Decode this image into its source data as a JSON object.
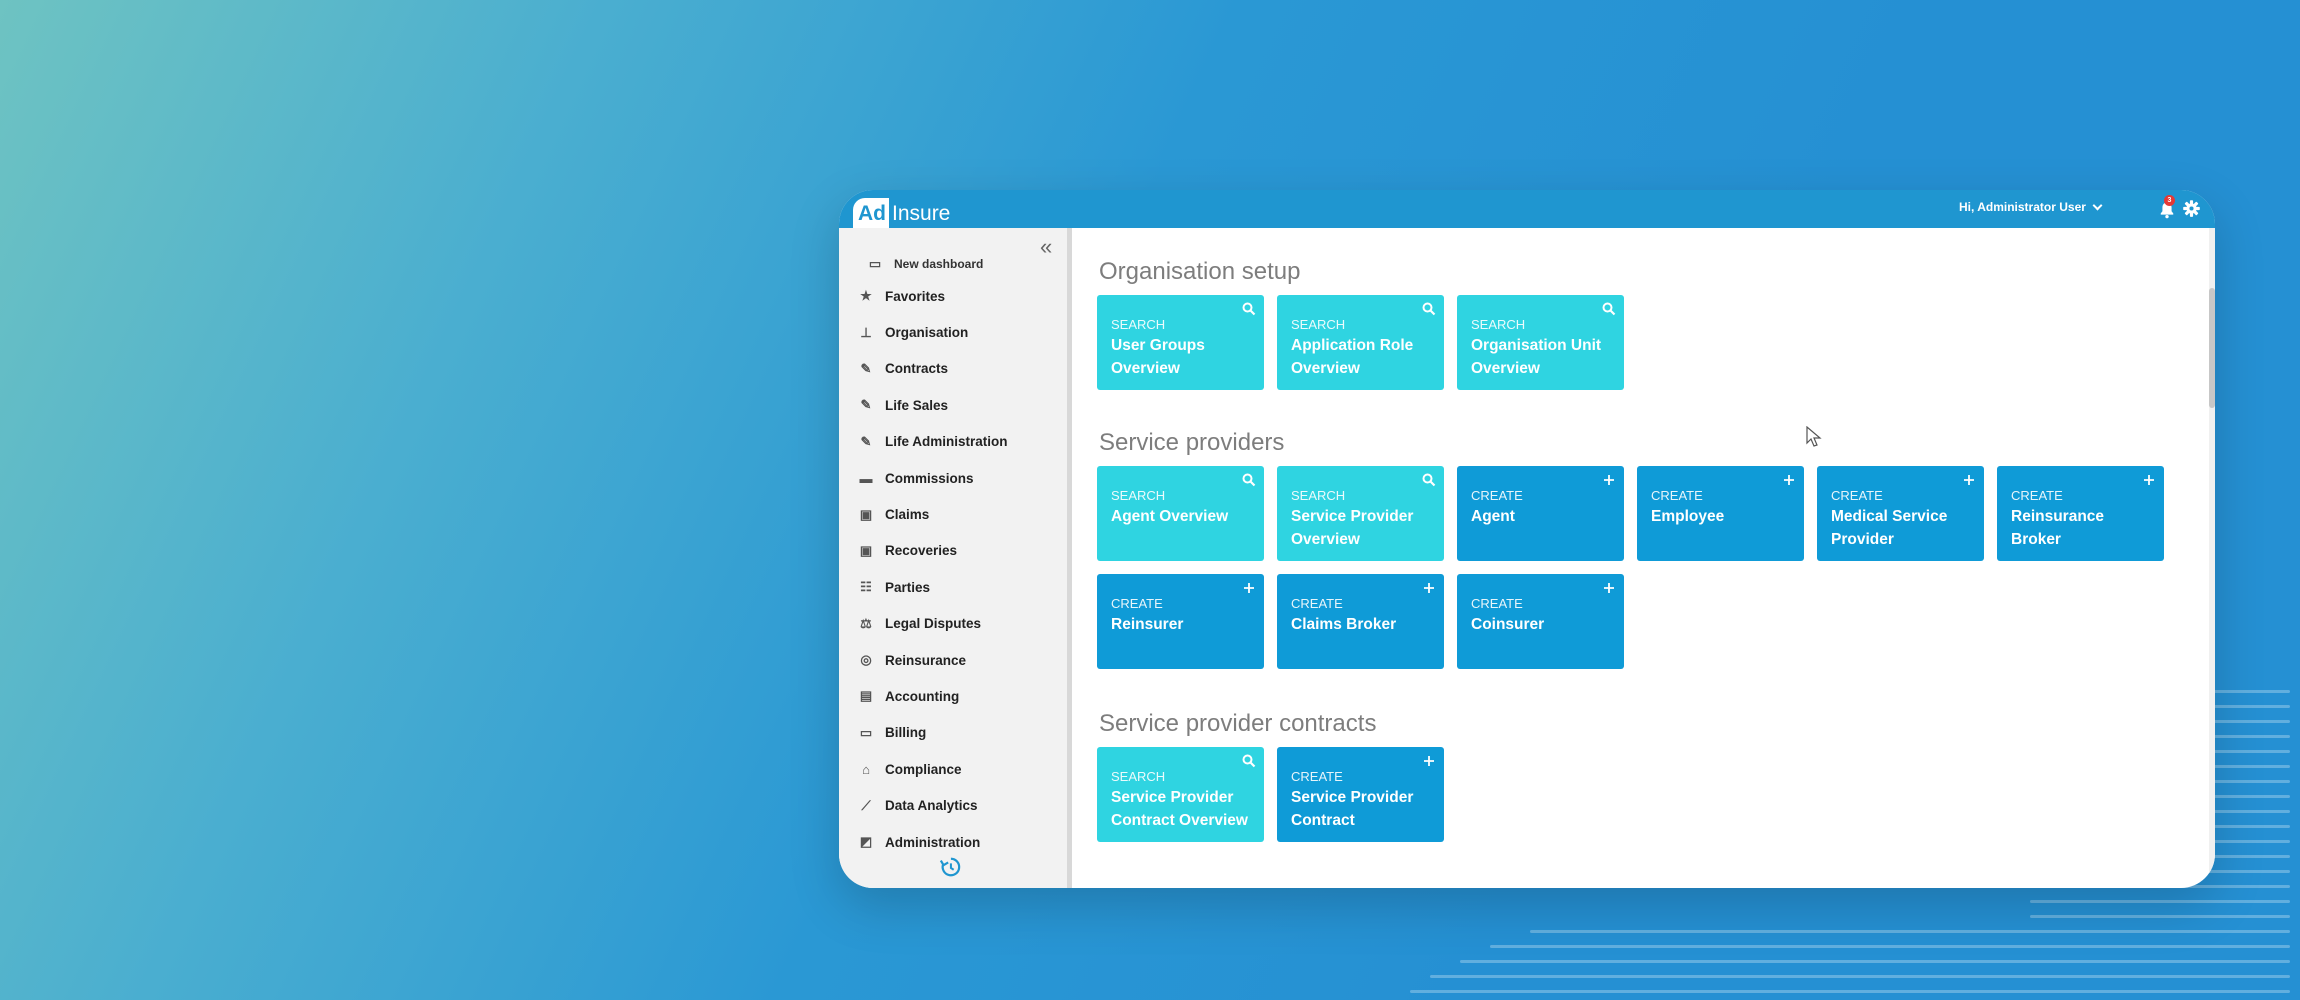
{
  "brand": {
    "logo_left": "Ad",
    "logo_right": "Insure"
  },
  "header": {
    "greeting": "Hi, Administrator User",
    "notification_count": "3"
  },
  "sidebar": {
    "items": [
      {
        "label": "New dashboard",
        "icon": "dashboard-icon"
      },
      {
        "label": "Favorites",
        "icon": "star-icon"
      },
      {
        "label": "Organisation",
        "icon": "org-chart-icon"
      },
      {
        "label": "Contracts",
        "icon": "contract-icon"
      },
      {
        "label": "Life Sales",
        "icon": "contract-icon"
      },
      {
        "label": "Life Administration",
        "icon": "contract-icon"
      },
      {
        "label": "Commissions",
        "icon": "wallet-icon"
      },
      {
        "label": "Claims",
        "icon": "briefcase-icon"
      },
      {
        "label": "Recoveries",
        "icon": "briefcase-icon"
      },
      {
        "label": "Parties",
        "icon": "people-icon"
      },
      {
        "label": "Legal Disputes",
        "icon": "scales-icon"
      },
      {
        "label": "Reinsurance",
        "icon": "reinsurance-icon"
      },
      {
        "label": "Accounting",
        "icon": "ledger-icon"
      },
      {
        "label": "Billing",
        "icon": "card-icon"
      },
      {
        "label": "Compliance",
        "icon": "bank-icon"
      },
      {
        "label": "Data Analytics",
        "icon": "line-chart-icon"
      },
      {
        "label": "Administration",
        "icon": "admin-icon"
      }
    ]
  },
  "sections": [
    {
      "title": "Organisation setup",
      "tiles": [
        {
          "kind": "SEARCH",
          "lines": [
            "User Groups",
            "Overview"
          ]
        },
        {
          "kind": "SEARCH",
          "lines": [
            "Application Role",
            "Overview"
          ]
        },
        {
          "kind": "SEARCH",
          "lines": [
            "Organisation Unit",
            "Overview"
          ]
        }
      ]
    },
    {
      "title": "Service providers",
      "tiles": [
        {
          "kind": "SEARCH",
          "lines": [
            "Agent Overview",
            ""
          ]
        },
        {
          "kind": "SEARCH",
          "lines": [
            "Service Provider",
            "Overview"
          ]
        },
        {
          "kind": "CREATE",
          "lines": [
            "Agent",
            ""
          ]
        },
        {
          "kind": "CREATE",
          "lines": [
            "Employee",
            ""
          ]
        },
        {
          "kind": "CREATE",
          "lines": [
            "Medical Service",
            "Provider"
          ]
        },
        {
          "kind": "CREATE",
          "lines": [
            "Reinsurance Broker",
            ""
          ]
        },
        {
          "kind": "CREATE",
          "lines": [
            "Reinsurer",
            ""
          ]
        },
        {
          "kind": "CREATE",
          "lines": [
            "Claims Broker",
            ""
          ]
        },
        {
          "kind": "CREATE",
          "lines": [
            "Coinsurer",
            ""
          ]
        }
      ]
    },
    {
      "title": "Service provider contracts",
      "tiles": [
        {
          "kind": "SEARCH",
          "lines": [
            "Service Provider",
            "Contract Overview"
          ]
        },
        {
          "kind": "CREATE",
          "lines": [
            "Service Provider",
            "Contract"
          ]
        }
      ]
    }
  ],
  "colors": {
    "header": "#1f96d0",
    "search_tile": "#2fd4e1",
    "create_tile": "#0f9bd7"
  }
}
